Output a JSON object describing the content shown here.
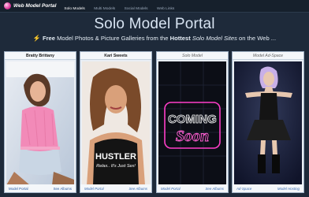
{
  "header": {
    "brand": "Web Model Portal",
    "nav": [
      "Solo Models",
      "Multi Models",
      "Social Models",
      "Web Links"
    ]
  },
  "title": "Solo Model Portal",
  "tagline": {
    "bolt_icon": "lightning-bolt-icon",
    "free": "Free",
    "part1": " Model Photos & Picture Galleries from the ",
    "hottest": "Hottest",
    "space": " ",
    "solo_sites": "Solo Model Sites",
    "part2": " on the Web ..."
  },
  "cards": [
    {
      "title": "Bratty Brittany",
      "links": [
        "Model Portal",
        "See Albums"
      ]
    },
    {
      "title": "Kari Sweets",
      "links": [
        "Model Portal",
        "See Albums"
      ]
    },
    {
      "title": "Solo Model",
      "links": [
        "Model Portal",
        "See Albums"
      ],
      "image_text": "COMING Soon"
    },
    {
      "title": "Model Ad-Space",
      "links": [
        "Ad-Space",
        "Model Hosting"
      ]
    }
  ],
  "colors": {
    "background": "#1e2a3a",
    "topbar": "#16202c",
    "link": "#2a5aa0",
    "bolt": "#ffc828",
    "coming_soon_neon": "#ff3ec8"
  }
}
